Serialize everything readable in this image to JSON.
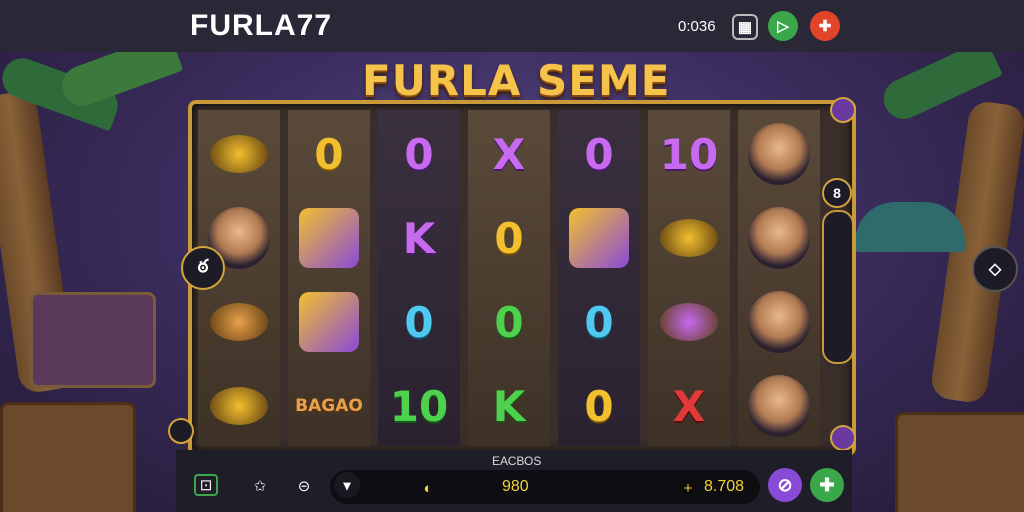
{
  "header": {
    "brand": "FURLA77",
    "clock": "0:036",
    "icons": [
      "cards-icon",
      "play-icon",
      "gift-icon"
    ]
  },
  "game": {
    "title": "FURLA SEME",
    "reels": [
      [
        {
          "type": "coin",
          "label": ""
        },
        {
          "type": "portrait",
          "label": ""
        },
        {
          "type": "coin",
          "label": ""
        },
        {
          "type": "coin",
          "label": ""
        }
      ],
      [
        {
          "type": "text",
          "label": "0",
          "color": "gold"
        },
        {
          "type": "icon",
          "label": ""
        },
        {
          "type": "icon",
          "label": ""
        },
        {
          "type": "text",
          "label": "BAGAO",
          "color": "brown"
        }
      ],
      [
        {
          "type": "text",
          "label": "0",
          "color": "purple"
        },
        {
          "type": "text",
          "label": "K",
          "color": "purple"
        },
        {
          "type": "text",
          "label": "0",
          "color": "blue"
        },
        {
          "type": "text",
          "label": "10",
          "color": "green"
        }
      ],
      [
        {
          "type": "text",
          "label": "X",
          "color": "purple"
        },
        {
          "type": "text",
          "label": "0",
          "color": "gold"
        },
        {
          "type": "text",
          "label": "0",
          "color": "green"
        },
        {
          "type": "text",
          "label": "K",
          "color": "green"
        }
      ],
      [
        {
          "type": "text",
          "label": "0",
          "color": "purple"
        },
        {
          "type": "icon",
          "label": ""
        },
        {
          "type": "text",
          "label": "0",
          "color": "blue"
        },
        {
          "type": "text",
          "label": "0",
          "color": "gold"
        }
      ],
      [
        {
          "type": "text",
          "label": "10",
          "color": "purple"
        },
        {
          "type": "coin",
          "label": ""
        },
        {
          "type": "coin",
          "label": ""
        },
        {
          "type": "text",
          "label": "X",
          "color": "red"
        }
      ],
      [
        {
          "type": "portrait",
          "label": ""
        },
        {
          "type": "portrait",
          "label": ""
        },
        {
          "type": "portrait",
          "label": ""
        },
        {
          "type": "portrait",
          "label": ""
        }
      ]
    ],
    "side_left_glyph": "ఠ",
    "side_right_glyph": "8"
  },
  "bottom": {
    "bets_label": "ЕАСВОЅ",
    "bet_value": "980",
    "balance_value": "8.708",
    "icons": [
      "chart-icon",
      "star-icon",
      "controller-icon",
      "down-arrow-icon",
      "globe-icon",
      "plus-icon"
    ]
  },
  "colors": {
    "gold": "#f2c02e",
    "purple": "#c76af0",
    "accent_green": "#3aa84a",
    "accent_red": "#e0452a",
    "accent_violet": "#8a4ad8"
  }
}
